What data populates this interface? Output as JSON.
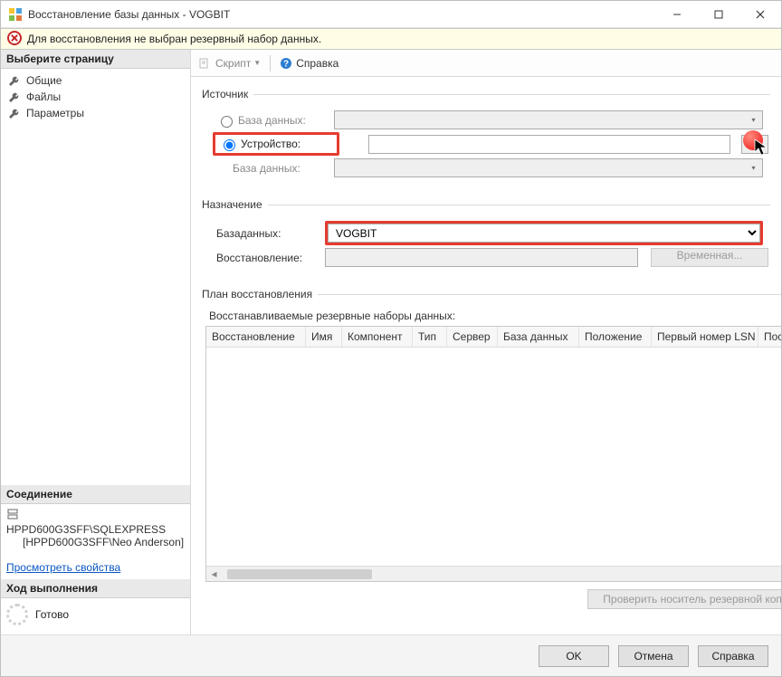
{
  "window": {
    "title": "Восстановление базы данных - VOGBIT"
  },
  "error_bar": {
    "message": "Для восстановления не выбран резервный набор данных."
  },
  "sidebar": {
    "select_page": "Выберите страницу",
    "items": [
      {
        "label": "Общие"
      },
      {
        "label": "Файлы"
      },
      {
        "label": "Параметры"
      }
    ],
    "connection_header": "Соединение",
    "connection_server": "HPPD600G3SFF\\SQLEXPRESS",
    "connection_user": "[HPPD600G3SFF\\Neo Anderson]",
    "view_props": "Просмотреть свойства",
    "progress_header": "Ход выполнения",
    "ready": "Готово"
  },
  "topbar": {
    "script": "Скрипт",
    "help": "Справка"
  },
  "source": {
    "legend": "Источник",
    "radio_db": "База данных:",
    "radio_device": "Устройство:",
    "db_under_device": "База данных:"
  },
  "destination": {
    "legend": "Назначение",
    "db_label": "Базаданных:",
    "db_value": "VOGBIT",
    "restore_label": "Восстановление:",
    "temp_btn": "Временная..."
  },
  "plan": {
    "legend": "План восстановления",
    "sets_label": "Восстанавливаемые резервные наборы данных:",
    "columns": [
      "Восстановление",
      "Имя",
      "Компонент",
      "Тип",
      "Сервер",
      "База данных",
      "Положение",
      "Первый номер LSN",
      "Последн"
    ]
  },
  "verify_btn": "Проверить носитель резервной копии",
  "footer": {
    "ok": "OK",
    "cancel": "Отмена",
    "help": "Справка"
  }
}
